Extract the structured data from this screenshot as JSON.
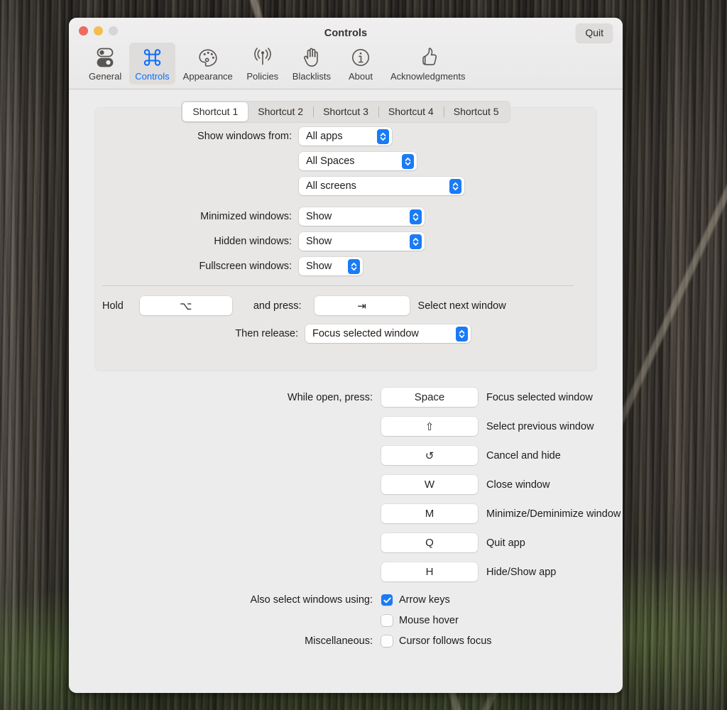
{
  "window": {
    "title": "Controls",
    "quit_label": "Quit",
    "traffic": {
      "close": "close-button",
      "minimize": "minimize-button",
      "zoom": "zoom-button"
    }
  },
  "toolbar": {
    "items": [
      {
        "label": "General",
        "icon": "toggles-icon",
        "active": false
      },
      {
        "label": "Controls",
        "icon": "command-icon",
        "active": true
      },
      {
        "label": "Appearance",
        "icon": "palette-icon",
        "active": false
      },
      {
        "label": "Policies",
        "icon": "broadcast-icon",
        "active": false
      },
      {
        "label": "Blacklists",
        "icon": "hand-icon",
        "active": false
      },
      {
        "label": "About",
        "icon": "info-icon",
        "active": false
      },
      {
        "label": "Acknowledgments",
        "icon": "thumbsup-icon",
        "active": false
      }
    ]
  },
  "tabs": [
    {
      "label": "Shortcut 1",
      "active": true
    },
    {
      "label": "Shortcut 2",
      "active": false
    },
    {
      "label": "Shortcut 3",
      "active": false
    },
    {
      "label": "Shortcut 4",
      "active": false
    },
    {
      "label": "Shortcut 5",
      "active": false
    }
  ],
  "group": {
    "show_windows_from": {
      "label": "Show windows from:",
      "apps": "All apps",
      "spaces": "All Spaces",
      "screens": "All screens"
    },
    "minimized": {
      "label": "Minimized windows:",
      "value": "Show"
    },
    "hidden": {
      "label": "Hidden windows:",
      "value": "Show"
    },
    "fullscreen": {
      "label": "Fullscreen windows:",
      "value": "Show"
    },
    "hold": {
      "hold_label": "Hold",
      "hold_key": "⌥",
      "and_press_label": "and press:",
      "press_key": "⇥",
      "press_desc": "Select next window"
    },
    "then_release": {
      "label": "Then release:",
      "value": "Focus selected window"
    }
  },
  "while_open": {
    "label": "While open, press:",
    "rows": [
      {
        "key": "Space",
        "desc": "Focus selected window"
      },
      {
        "key": "⇧",
        "desc": "Select previous window"
      },
      {
        "key": "↺",
        "desc": "Cancel and hide"
      },
      {
        "key": "W",
        "desc": "Close window"
      },
      {
        "key": "M",
        "desc": "Minimize/Deminimize window"
      },
      {
        "key": "Q",
        "desc": "Quit app"
      },
      {
        "key": "H",
        "desc": "Hide/Show app"
      }
    ]
  },
  "checkboxes": {
    "also_select_label": "Also select windows using:",
    "arrow_keys": {
      "label": "Arrow keys",
      "checked": true
    },
    "mouse_hover": {
      "label": "Mouse hover",
      "checked": false
    },
    "misc_label": "Miscellaneous:",
    "cursor_follows": {
      "label": "Cursor follows focus",
      "checked": false
    }
  },
  "colors": {
    "accent": "#1a7bf5",
    "active_tint": "#0a6cff",
    "window_bg": "#ececec",
    "group_bg": "#e8e7e5",
    "toolbar_bg": "#efeeee"
  }
}
